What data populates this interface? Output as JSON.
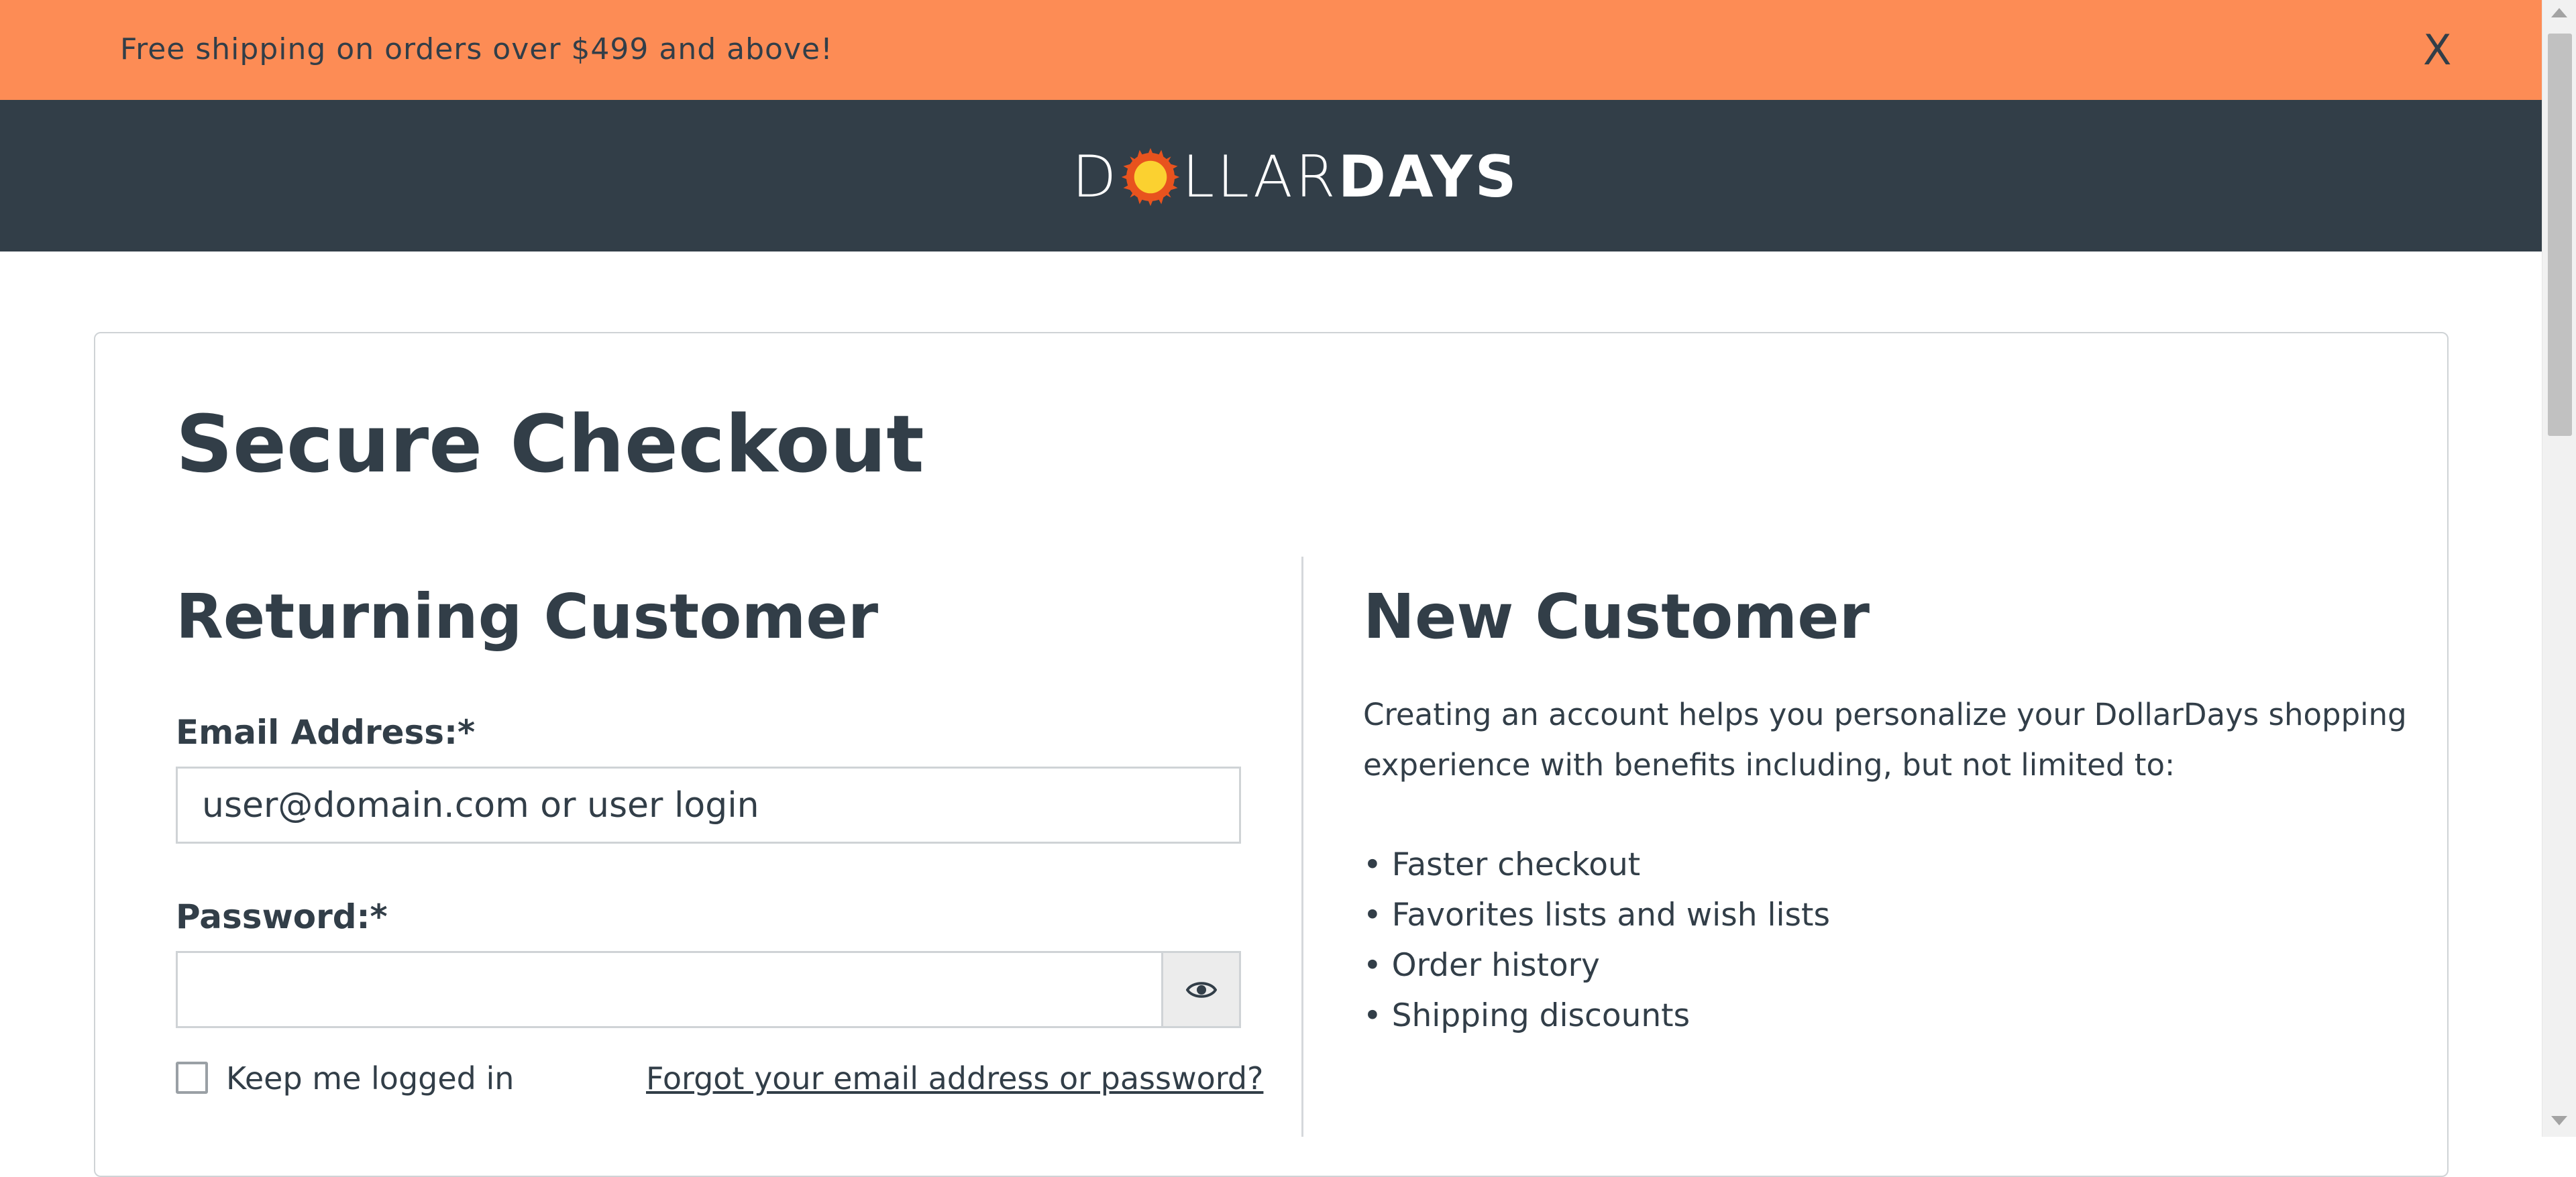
{
  "promo": {
    "text": "Free shipping on orders over $499 and above!",
    "close_label": "X"
  },
  "logo": {
    "part_light_start": "D",
    "part_light_end": "LLAR",
    "part_bold": "DAYS"
  },
  "page": {
    "title": "Secure Checkout"
  },
  "returning": {
    "title": "Returning Customer",
    "email_label": "Email Address:*",
    "email_placeholder": "user@domain.com or user login",
    "password_label": "Password:*",
    "keep_logged_in_label": "Keep me logged in",
    "forgot_link": "Forgot your email address or password?"
  },
  "new_customer": {
    "title": "New Customer",
    "description": "Creating an account helps you personalize your DollarDays shopping experience with benefits including, but not limited to:",
    "benefits": [
      "• Faster checkout",
      "• Favorites lists and wish lists",
      "• Order history",
      "• Shipping discounts"
    ]
  },
  "colors": {
    "promo_bg": "#fd8c55",
    "header_bg": "#323e48",
    "text": "#323e48",
    "sun_outer": "#e8531e",
    "sun_inner": "#fbd130"
  }
}
